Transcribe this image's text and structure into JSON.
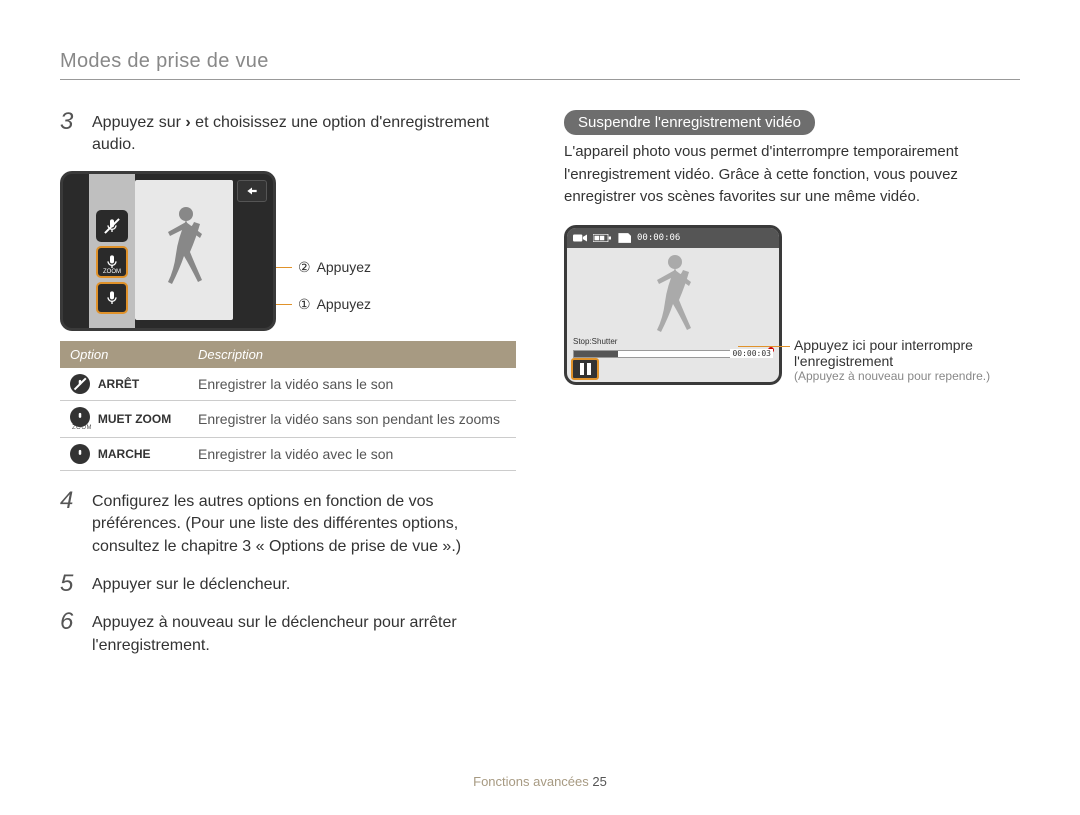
{
  "header": {
    "title": "Modes de prise de vue"
  },
  "left": {
    "step3": {
      "num": "3",
      "text_a": "Appuyez sur ",
      "text_b": " et choisissez une option d'enregistrement audio."
    },
    "callouts": {
      "two": "Appuyez",
      "one": "Appuyez"
    },
    "table": {
      "head": {
        "option": "Option",
        "description": "Description"
      },
      "rows": [
        {
          "name": "ARRÊT",
          "desc": "Enregistrer la vidéo sans le son",
          "icon": "off"
        },
        {
          "name": "MUET ZOOM",
          "desc": "Enregistrer la vidéo sans son pendant les zooms",
          "icon": "zoom"
        },
        {
          "name": "MARCHE",
          "desc": "Enregistrer la vidéo avec le son",
          "icon": "on"
        }
      ]
    },
    "step4": {
      "num": "4",
      "text": "Configurez les autres options en fonction de vos préférences. (Pour une liste des différentes options, consultez le chapitre 3 « Options de prise de vue ».)"
    },
    "step5": {
      "num": "5",
      "text": "Appuyer sur le déclencheur."
    },
    "step6": {
      "num": "6",
      "text": "Appuyez à nouveau sur le déclencheur pour arrêter l'enregistrement."
    }
  },
  "right": {
    "pill": "Suspendre l'enregistrement vidéo",
    "para": "L'appareil photo vous permet d'interrompre temporairement l'enregistrement vidéo. Grâce à cette fonction, vous pouvez enregistrer vos scènes favorites sur une même vidéo.",
    "topbar": {
      "time_total": "00:00:06"
    },
    "stop_label": "Stop:Shutter",
    "bar_time": "00:00:03",
    "callout": {
      "line1": "Appuyez ici pour interrompre l'enregistrement",
      "hint": "(Appuyez à nouveau pour rependre.)"
    }
  },
  "footer": {
    "section": "Fonctions avancées",
    "page": "25"
  }
}
